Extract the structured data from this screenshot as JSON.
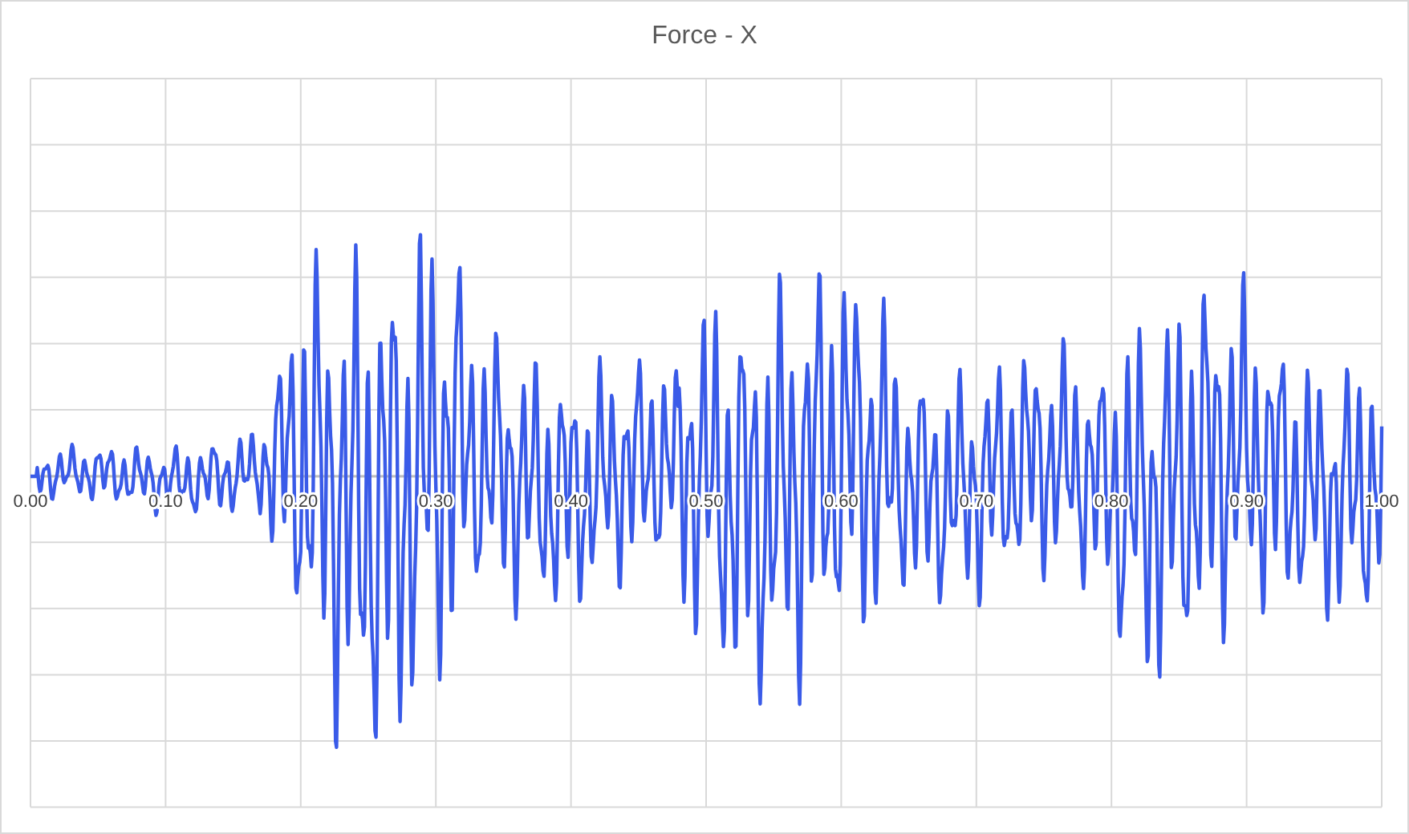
{
  "chart": {
    "title": "Force - X",
    "x_tick_labels": [
      "0.00",
      "0.10",
      "0.20",
      "0.30",
      "0.40",
      "0.50",
      "0.60",
      "0.70",
      "0.80",
      "0.90",
      "1.00"
    ]
  }
}
